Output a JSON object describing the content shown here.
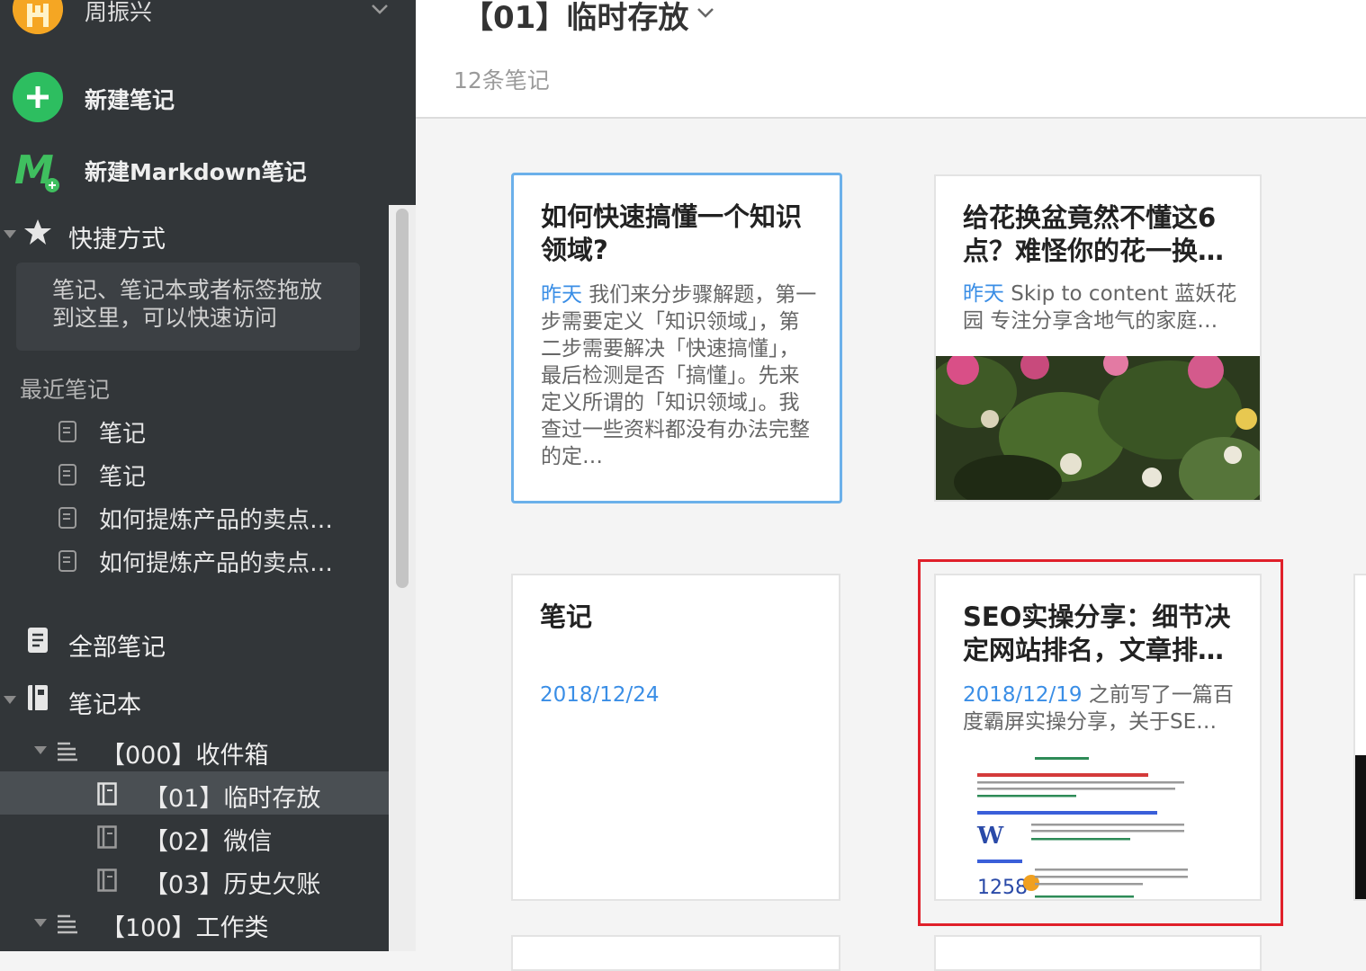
{
  "sidebar": {
    "user_name": "周振兴",
    "new_note": "新建笔记",
    "new_markdown": "新建Markdown笔记",
    "shortcuts_label": "快捷方式",
    "shortcuts_hint": "笔记、笔记本或者标签拖放到这里，可以快速访问",
    "recent_title": "最近笔记",
    "recent": [
      {
        "label": "笔记"
      },
      {
        "label": "笔记"
      },
      {
        "label": "如何提炼产品的卖点…"
      },
      {
        "label": "如何提炼产品的卖点…"
      }
    ],
    "all_notes": "全部笔记",
    "notebooks_label": "笔记本",
    "notebooks": [
      {
        "label": "【000】收件箱"
      },
      {
        "label": "【01】临时存放"
      },
      {
        "label": "【02】微信"
      },
      {
        "label": "【03】历史欠账"
      },
      {
        "label": "【100】工作类"
      }
    ]
  },
  "main": {
    "notebook_title": "【01】临时存放",
    "note_count": "12条笔记",
    "cards": [
      {
        "title": "如何快速搞懂一个知识领域?",
        "date": "昨天",
        "snippet": " 我们来分步骤解题，第一步需要定义「知识领域」，第二步需要解决「快速搞懂」，最后检测是否「搞懂」。先来定义所谓的「知识领域」。我查过一些资料都没有办法完整的定…"
      },
      {
        "title": "给花换盆竟然不懂这6点？难怪你的花一换…",
        "date": "昨天",
        "snippet": " Skip to content 蓝妖花园 专注分享含地气的家庭…"
      },
      {
        "title": "笔记",
        "date": "2018/12/24",
        "snippet": ""
      },
      {
        "title": "SEO实操分享：细节决定网站排名，文章排…",
        "date": "2018/12/19",
        "snippet": " 之前写了一篇百度霸屏实操分享，关于SE…"
      }
    ]
  },
  "colors": {
    "sidebar_bg": "#323639",
    "accent_green": "#2dbe60",
    "date_blue": "#3a8ee6",
    "selection_blue": "#6bb0ea",
    "highlight_red": "#e0202a"
  }
}
